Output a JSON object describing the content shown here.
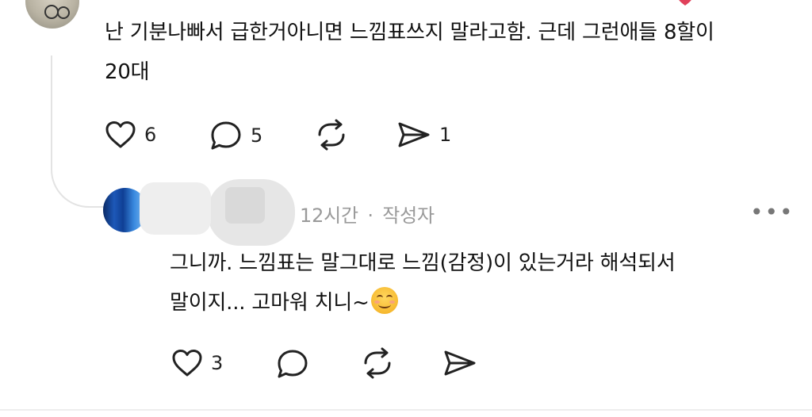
{
  "post": {
    "text_line1": "난 기분나빠서 급한거아니면 느낌표쓰지 말라고함. 근데 그런애들 8할이",
    "text_line2": "20대",
    "actions": {
      "like_count": "6",
      "comment_count": "5",
      "share_count": "1"
    }
  },
  "reply": {
    "time": "12시간",
    "separator": "·",
    "author_badge": "작성자",
    "text_line1": "그니까. 느낌표는 말그대로 느낌(감정)이 있는거라 해석되서",
    "text_line2": "말이지... 고마워 치니~",
    "emoji": "smiling-face-emoji",
    "more_label": "•••",
    "actions": {
      "like_count": "3"
    }
  },
  "colors": {
    "text": "#111111",
    "meta": "#9a9a9a",
    "divider": "#e3e3e3"
  }
}
